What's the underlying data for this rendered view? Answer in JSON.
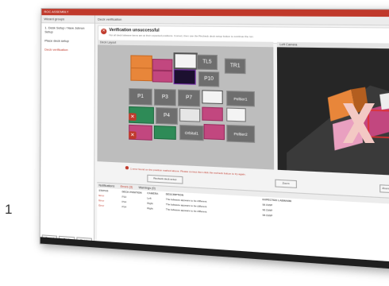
{
  "window": {
    "title": "ROC ASSEMBLY",
    "sidebar_header": "Wizard groups",
    "sidebar_items": [
      "1. Desk Setup / New Jobrun Setup",
      "Place deck setup",
      "Deck verification"
    ],
    "sidebar_buttons": [
      "Cancel",
      "Back",
      "Finish"
    ],
    "content_header": "Deck verification",
    "alert_title": "Verification unsuccessful",
    "alert_sub": "Not all deck labware items are at their expected positions. Correct, then use the Recheck deck setup button to continue the run."
  },
  "panels": {
    "deck_layout_label": "Deck Layout",
    "camera_label": "Left Camera"
  },
  "deck_modules": {
    "tl5": "TL5",
    "tr1": "TR1",
    "p10": "P10",
    "p1": "P1",
    "p3": "P3",
    "p7": "P7",
    "peltier1": "Peltier1",
    "p4": "P4",
    "orbital1": "Orbital1",
    "peltier2": "Peltier2"
  },
  "bottom": {
    "warning": "1 error found on the position marked above. Please correct then click the recheck button to try again.",
    "recheck_button": "Recheck deck setup",
    "zoom_button": "Zoom",
    "camera_button": "Zoom to selected Position"
  },
  "notifications": {
    "header": "Notifications",
    "filter_errors": "Errors (3)",
    "filter_warnings": "Warnings (0)",
    "columns": [
      "STATUS",
      "DECK POSITION",
      "CAMERA",
      "DESCRIPTION",
      "EXPECTED LABWARE"
    ],
    "rows": [
      [
        "Error",
        "P10",
        "Left",
        "The labware appears to be different",
        "96 DWP"
      ],
      [
        "Error",
        "P14",
        "Right",
        "The labware appears to be different",
        "96 DWP"
      ],
      [
        "Error",
        "P14",
        "Right",
        "The labware appears to be different",
        "96 DWP"
      ]
    ]
  },
  "page_number": "1",
  "colors": {
    "accent": "#c0392b",
    "orange": "#e8863a",
    "pink": "#c2477f",
    "green": "#2e8b57"
  }
}
